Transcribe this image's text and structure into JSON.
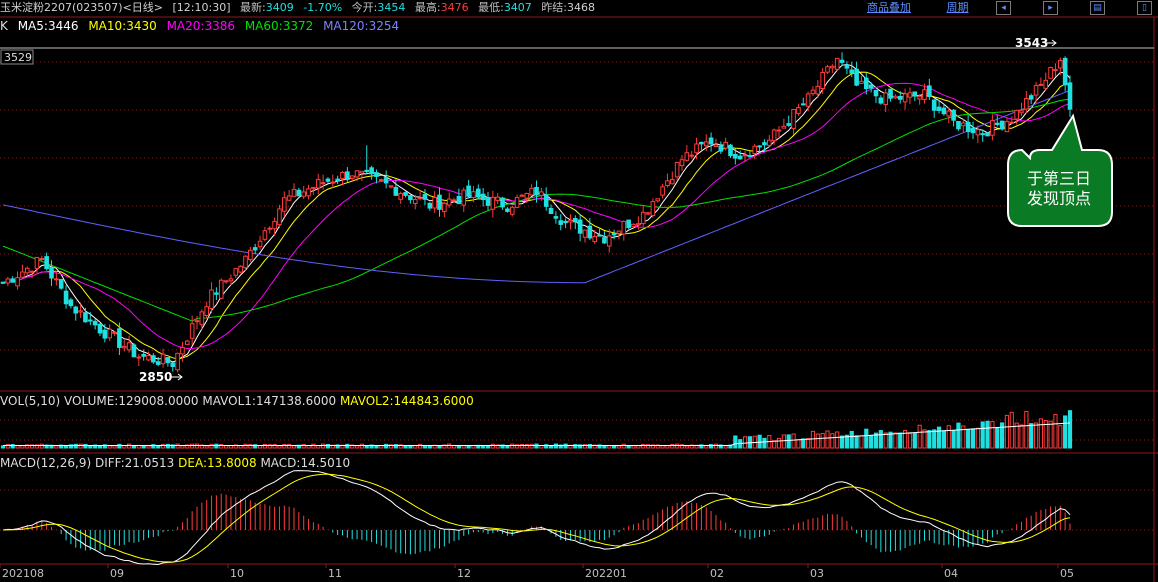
{
  "header": {
    "instrument": "玉米淀粉2207(023507)<日线>",
    "time": "[12:10:30]",
    "latest_label": "最新:",
    "latest_value": "3409",
    "change": "-1.70%",
    "open_label": "今开:",
    "open_value": "3454",
    "high_label": "最高:",
    "high_value": "3476",
    "low_label": "最低:",
    "low_value": "3407",
    "prev_label": "昨结:",
    "prev_value": "3468",
    "overlay_button": "商品叠加",
    "period_button": "周期"
  },
  "ma_legend": {
    "k": "K",
    "ma5": "MA5:3446",
    "ma10": "MA10:3430",
    "ma20": "MA20:3386",
    "ma60": "MA60:3372",
    "ma120": "MA120:3254"
  },
  "price_axis_label": "3529",
  "annotations": {
    "high": "3543",
    "low": "2850",
    "bubble_line1": "于第三日",
    "bubble_line2": "发现顶点"
  },
  "vol_legend": {
    "name": "VOL(5,10)",
    "volume": "VOLUME:129008.0000",
    "mavol1": "MAVOL1:147138.6000",
    "mavol2": "MAVOL2:144843.6000"
  },
  "macd_legend": {
    "name": "MACD(12,26,9)",
    "diff": "DIFF:21.0513",
    "dea": "DEA:13.8008",
    "macd": "MACD:14.5010"
  },
  "colors": {
    "up": "#ff3b3b",
    "down": "#1fe0e0",
    "ma5": "#ffffff",
    "ma10": "#ffff00",
    "ma20": "#ff00ff",
    "ma60": "#00e000",
    "ma120": "#6060ff"
  },
  "chart_data": {
    "type": "candlestick",
    "x_ticks": [
      "202108",
      "09",
      "10",
      "11",
      "12",
      "202201",
      "02",
      "03",
      "04",
      "05"
    ],
    "price_range": [
      2800,
      3560
    ],
    "price_anchors": [
      {
        "i": 0,
        "c": 3030
      },
      {
        "i": 8,
        "c": 3080
      },
      {
        "i": 14,
        "c": 2980
      },
      {
        "i": 20,
        "c": 2930
      },
      {
        "i": 28,
        "c": 2870
      },
      {
        "i": 35,
        "c": 2855
      },
      {
        "i": 42,
        "c": 2990
      },
      {
        "i": 50,
        "c": 3080
      },
      {
        "i": 58,
        "c": 3210
      },
      {
        "i": 66,
        "c": 3250
      },
      {
        "i": 72,
        "c": 3270
      },
      {
        "i": 80,
        "c": 3240
      },
      {
        "i": 88,
        "c": 3200
      },
      {
        "i": 96,
        "c": 3220
      },
      {
        "i": 104,
        "c": 3200
      },
      {
        "i": 110,
        "c": 3230
      },
      {
        "i": 116,
        "c": 3160
      },
      {
        "i": 124,
        "c": 3130
      },
      {
        "i": 132,
        "c": 3180
      },
      {
        "i": 140,
        "c": 3300
      },
      {
        "i": 146,
        "c": 3340
      },
      {
        "i": 152,
        "c": 3310
      },
      {
        "i": 158,
        "c": 3340
      },
      {
        "i": 166,
        "c": 3430
      },
      {
        "i": 172,
        "c": 3520
      },
      {
        "i": 176,
        "c": 3460
      },
      {
        "i": 182,
        "c": 3430
      },
      {
        "i": 190,
        "c": 3440
      },
      {
        "i": 196,
        "c": 3380
      },
      {
        "i": 202,
        "c": 3360
      },
      {
        "i": 208,
        "c": 3390
      },
      {
        "i": 214,
        "c": 3460
      },
      {
        "i": 218,
        "c": 3520
      },
      {
        "i": 220,
        "c": 3409
      }
    ],
    "mavol_level": 147138.6,
    "macd_last": {
      "diff": 21.0513,
      "dea": 13.8008,
      "macd": 14.501
    }
  }
}
